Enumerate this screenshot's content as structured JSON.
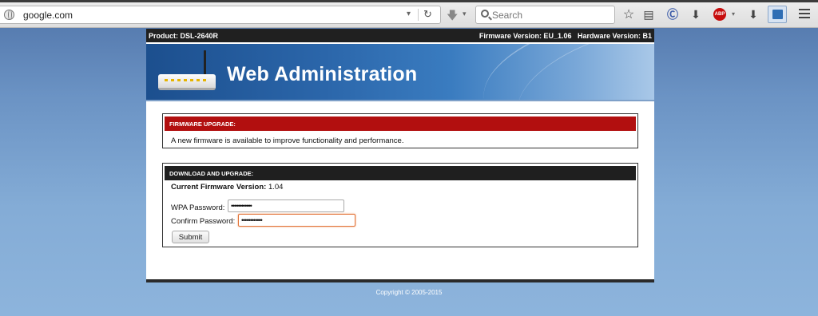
{
  "browser": {
    "url": "google.com",
    "search_placeholder": "Search",
    "abp_label": "ABP"
  },
  "header": {
    "product": "Product: DSL-2640R",
    "versions": "Firmware Version: EU_1.06   Hardware Version: B1"
  },
  "banner": {
    "title": "Web Administration"
  },
  "firmware_upgrade": {
    "title": "FIRMWARE UPGRADE:",
    "message": "A new firmware is available to improve functionality and performance."
  },
  "download_upgrade": {
    "title": "DOWNLOAD AND UPGRADE:",
    "current_label": "Current Firmware Version:",
    "current_value": " 1.04",
    "wpa_label": "WPA Password:",
    "wpa_value": "••••••••••••",
    "confirm_label": "Confirm Password:",
    "confirm_value": "••••••••••••",
    "submit_label": "Submit"
  },
  "footer": {
    "copyright": "Copyright © 2005-2015"
  },
  "colors": {
    "red_header": "#b20f0f",
    "dark_header": "#1f1f1f",
    "banner_blue": "#2b66aa",
    "background_blue": "#84acd6"
  }
}
